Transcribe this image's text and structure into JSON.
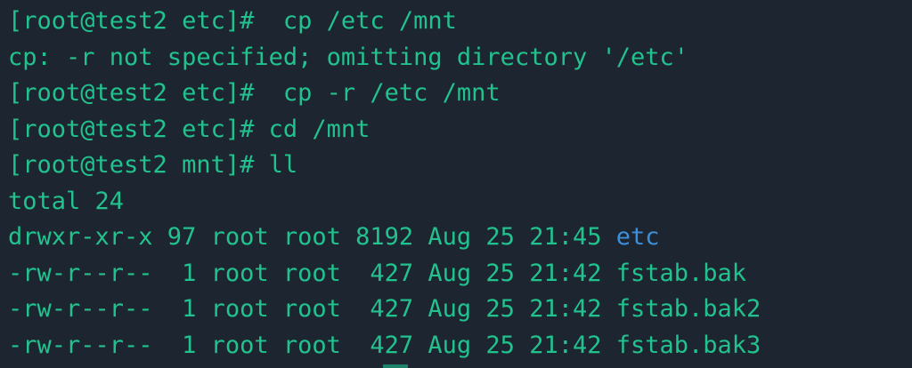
{
  "terminal": {
    "colors": {
      "background": "#1d2630",
      "text": "#22c28f",
      "directory": "#3b8fdc"
    },
    "lines": [
      {
        "prompt": "[root@test2 etc]#",
        "command": "  cp /etc /mnt"
      },
      {
        "text": "cp: -r not specified; omitting directory '/etc'"
      },
      {
        "prompt": "[root@test2 etc]#",
        "command": "  cp -r /etc /mnt"
      },
      {
        "prompt": "[root@test2 etc]#",
        "command": " cd /mnt"
      },
      {
        "prompt": "[root@test2 mnt]#",
        "command": " ll"
      },
      {
        "text": "total 24"
      }
    ],
    "listing": [
      {
        "prefix": "drwxr-xr-x 97 root root 8192 Aug 25 21:45 ",
        "name": "etc",
        "type": "directory"
      },
      {
        "prefix": "-rw-r--r--  1 root root  427 Aug 25 21:42 ",
        "name": "fstab.bak",
        "type": "file"
      },
      {
        "prefix": "-rw-r--r--  1 root root  427 Aug 25 21:42 ",
        "name": "fstab.bak2",
        "type": "file"
      },
      {
        "prefix": "-rw-r--r--  1 root root  427 Aug 25 21:42 ",
        "name": "fstab.bak3",
        "type": "file"
      }
    ]
  }
}
